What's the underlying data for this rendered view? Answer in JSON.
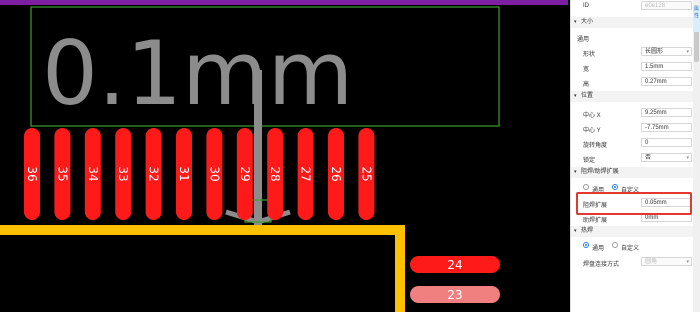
{
  "canvas": {
    "silk_text": "0.1mm",
    "pads_top": [
      "36",
      "35",
      "34",
      "33",
      "32",
      "31",
      "30",
      "29",
      "28",
      "27",
      "26",
      "25"
    ],
    "pads_side": [
      "24",
      "23"
    ],
    "colors": {
      "pad": "#ff1a1a",
      "pad_light": "#f08080",
      "silk": "#8c8c8c",
      "outline": "#ffc000",
      "box": "#3aa030",
      "top_bar": "#7c1fa0"
    }
  },
  "panel": {
    "id_label": "ID",
    "id_value": "e0e128",
    "size_section": "大小",
    "general_label": "通用",
    "shape_label": "形状",
    "shape_value": "长圆形",
    "width_label": "宽",
    "width_value": "1.5mm",
    "height_label": "高",
    "height_value": "0.27mm",
    "position_section": "位置",
    "cx_label": "中心 X",
    "cx_value": "9.25mm",
    "cy_label": "中心 Y",
    "cy_value": "-7.75mm",
    "rot_label": "旋转角度",
    "rot_value": "0",
    "lock_label": "锁定",
    "lock_value": "否",
    "mask_section": "阻焊/助焊扩展",
    "mask_opt1": "通用",
    "mask_opt2": "自定义",
    "solder_label": "阻焊扩展",
    "solder_value": "0.05mm",
    "paste_label": "助焊扩展",
    "paste_value": "0mm",
    "thermal_section": "热焊",
    "thermal_opt1": "通用",
    "thermal_opt2": "自定义",
    "connect_label": "焊盘连接方式",
    "connect_value": "圆角",
    "side_tab": "属性"
  }
}
